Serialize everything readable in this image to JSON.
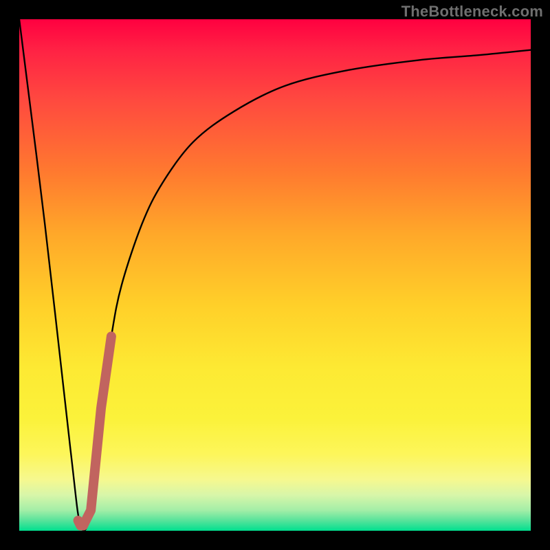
{
  "watermark": "TheBottleneck.com",
  "colors": {
    "frame": "#000000",
    "curve": "#000000",
    "highlight": "#c1645f"
  },
  "chart_data": {
    "type": "line",
    "title": "",
    "xlabel": "",
    "ylabel": "",
    "xlim": [
      0,
      100
    ],
    "ylim": [
      0,
      100
    ],
    "grid": false,
    "series": [
      {
        "name": "bottleneck-curve",
        "x": [
          0,
          5,
          10,
          12,
          14,
          16,
          18,
          20,
          24,
          28,
          34,
          42,
          52,
          64,
          78,
          90,
          100
        ],
        "y": [
          100,
          60,
          16,
          1,
          4,
          24,
          38,
          48,
          60,
          68,
          76,
          82,
          87,
          90,
          92,
          93,
          94
        ]
      },
      {
        "name": "highlight-segment",
        "x": [
          11.5,
          12.0,
          12.5,
          14.0,
          16.0,
          18.0
        ],
        "y": [
          2.0,
          1.0,
          1.0,
          4.0,
          24.0,
          38.0
        ]
      }
    ],
    "annotations": []
  }
}
